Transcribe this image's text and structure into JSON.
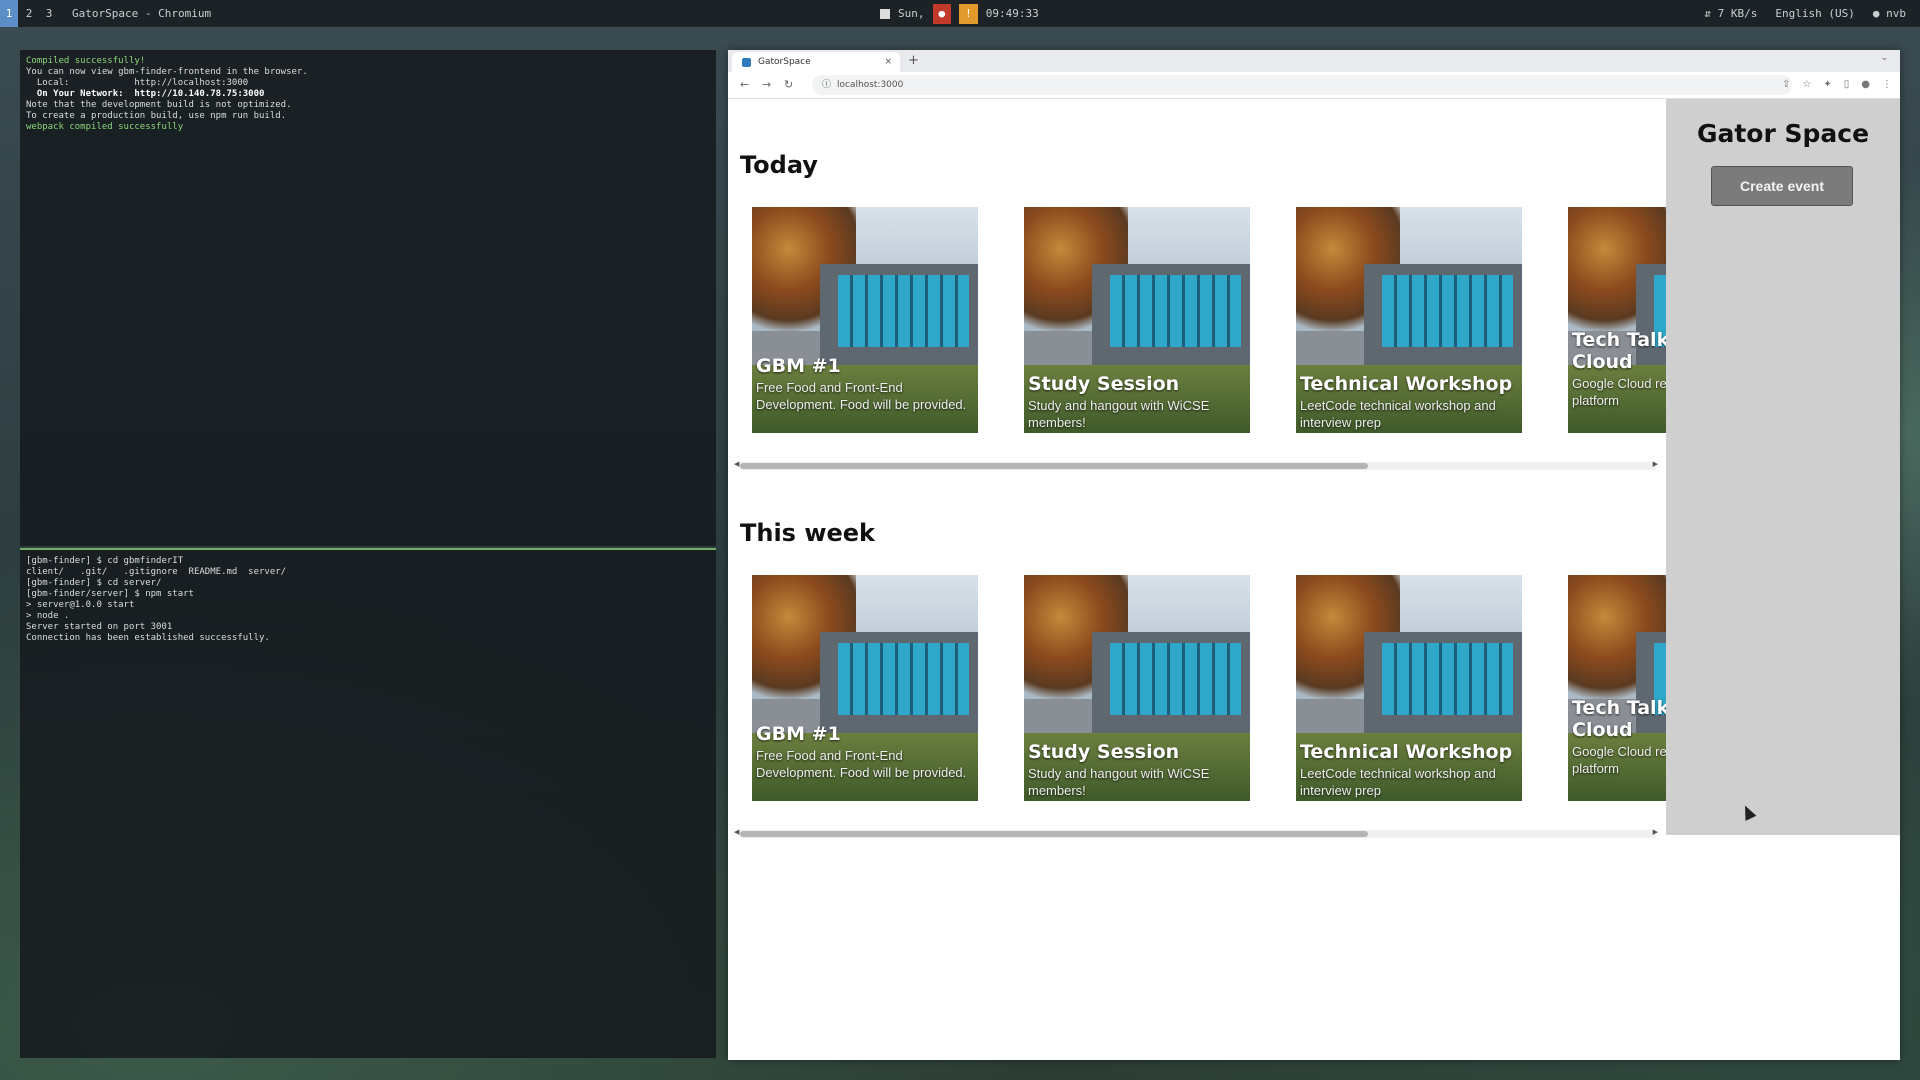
{
  "topbar": {
    "workspaces": [
      "1",
      "2",
      "3"
    ],
    "window_title": "GatorSpace - Chromium",
    "date": "Sun,",
    "time": "09:49:33",
    "net_speed": "7 KB/s",
    "keyboard": "English (US)",
    "user": "nvb"
  },
  "terminal_top": {
    "lines": [
      {
        "t": "Compiled successfully!",
        "c": "green"
      },
      {
        "t": "",
        "c": ""
      },
      {
        "t": "You can now view gbm-finder-frontend in the browser.",
        "c": ""
      },
      {
        "t": "",
        "c": ""
      },
      {
        "t": "  Local:            http://localhost:3000",
        "c": ""
      },
      {
        "t": "  On Your Network:  http://10.140.78.75:3000",
        "c": "bold"
      },
      {
        "t": "",
        "c": ""
      },
      {
        "t": "Note that the development build is not optimized.",
        "c": ""
      },
      {
        "t": "To create a production build, use npm run build.",
        "c": ""
      },
      {
        "t": "",
        "c": ""
      },
      {
        "t": "webpack compiled successfully",
        "c": "green"
      }
    ]
  },
  "terminal_bottom": {
    "lines": [
      {
        "t": "[gbm-finder] $ cd gbmfinderIT",
        "c": ""
      },
      {
        "t": "client/   .git/   .gitignore  README.md  server/",
        "c": ""
      },
      {
        "t": "[gbm-finder] $ cd server/",
        "c": ""
      },
      {
        "t": "[gbm-finder/server] $ npm start",
        "c": ""
      },
      {
        "t": "",
        "c": ""
      },
      {
        "t": "> server@1.0.0 start",
        "c": ""
      },
      {
        "t": "> node .",
        "c": ""
      },
      {
        "t": "",
        "c": ""
      },
      {
        "t": "Server started on port 3001",
        "c": ""
      },
      {
        "t": "Connection has been established successfully.",
        "c": ""
      }
    ]
  },
  "browser": {
    "tab_title": "GatorSpace",
    "url": "localhost:3000"
  },
  "sidebar": {
    "title": "Gator Space",
    "create_button": "Create event"
  },
  "sections": [
    {
      "title": "Today",
      "events": [
        {
          "title": "GBM #1",
          "desc": "Free Food and Front-End Development. Food will be provided."
        },
        {
          "title": "Study Session",
          "desc": "Study and hangout with WiCSE members!"
        },
        {
          "title": "Technical Workshop",
          "desc": "LeetCode technical workshop and interview prep"
        },
        {
          "title": "Tech Talk: Google Cloud",
          "desc": "Google Cloud resume tips, cloud platform"
        }
      ]
    },
    {
      "title": "This week",
      "events": [
        {
          "title": "GBM #1",
          "desc": "Free Food and Front-End Development. Food will be provided."
        },
        {
          "title": "Study Session",
          "desc": "Study and hangout with WiCSE members!"
        },
        {
          "title": "Technical Workshop",
          "desc": "LeetCode technical workshop and interview prep"
        },
        {
          "title": "Tech Talk: Google Cloud",
          "desc": "Google Cloud resume tips, cloud platform"
        }
      ]
    }
  ]
}
